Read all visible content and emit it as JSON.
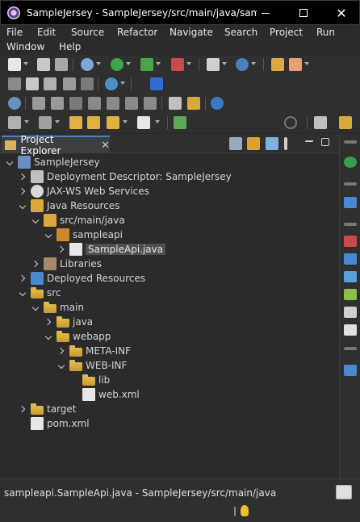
{
  "window": {
    "title": "SampleJersey - SampleJersey/src/main/java/sampl..."
  },
  "menu": {
    "items": [
      "File",
      "Edit",
      "Source",
      "Refactor",
      "Navigate",
      "Search",
      "Project",
      "Run",
      "Window",
      "Help"
    ]
  },
  "explorer": {
    "tab_label": "Project Explorer",
    "tree": [
      {
        "label": "SampleJersey",
        "depth": 0,
        "twisty": "open",
        "icon": "project-icon"
      },
      {
        "label": "Deployment Descriptor: SampleJersey",
        "depth": 1,
        "twisty": "closed",
        "icon": "deployment-descriptor-icon"
      },
      {
        "label": "JAX-WS Web Services",
        "depth": 1,
        "twisty": "closed",
        "icon": "web-services-icon"
      },
      {
        "label": "Java Resources",
        "depth": 1,
        "twisty": "open",
        "icon": "java-resources-icon"
      },
      {
        "label": "src/main/java",
        "depth": 2,
        "twisty": "open",
        "icon": "source-folder-icon"
      },
      {
        "label": "sampleapi",
        "depth": 3,
        "twisty": "open",
        "icon": "package-icon"
      },
      {
        "label": "SampleApi.java",
        "depth": 4,
        "twisty": "closed",
        "icon": "java-file-icon",
        "selected": true
      },
      {
        "label": "Libraries",
        "depth": 2,
        "twisty": "closed",
        "icon": "libraries-icon"
      },
      {
        "label": "Deployed Resources",
        "depth": 1,
        "twisty": "closed",
        "icon": "deployed-resources-icon"
      },
      {
        "label": "src",
        "depth": 1,
        "twisty": "open",
        "icon": "folder-icon"
      },
      {
        "label": "main",
        "depth": 2,
        "twisty": "open",
        "icon": "folder-icon"
      },
      {
        "label": "java",
        "depth": 3,
        "twisty": "closed",
        "icon": "folder-icon"
      },
      {
        "label": "webapp",
        "depth": 3,
        "twisty": "open",
        "icon": "folder-icon"
      },
      {
        "label": "META-INF",
        "depth": 4,
        "twisty": "closed",
        "icon": "folder-icon"
      },
      {
        "label": "WEB-INF",
        "depth": 4,
        "twisty": "open",
        "icon": "folder-icon"
      },
      {
        "label": "lib",
        "depth": 5,
        "twisty": "none",
        "icon": "folder-icon"
      },
      {
        "label": "web.xml",
        "depth": 5,
        "twisty": "none",
        "icon": "xml-file-icon"
      },
      {
        "label": "target",
        "depth": 1,
        "twisty": "closed",
        "icon": "folder-icon"
      },
      {
        "label": "pom.xml",
        "depth": 1,
        "twisty": "none",
        "icon": "maven-pom-icon"
      }
    ]
  },
  "status": {
    "text": "sampleapi.SampleApi.java - SampleJersey/src/main/java"
  },
  "colors": {
    "accent": "#4d7fbf",
    "folder": "#d9a93c",
    "background": "#2b2b2b"
  }
}
